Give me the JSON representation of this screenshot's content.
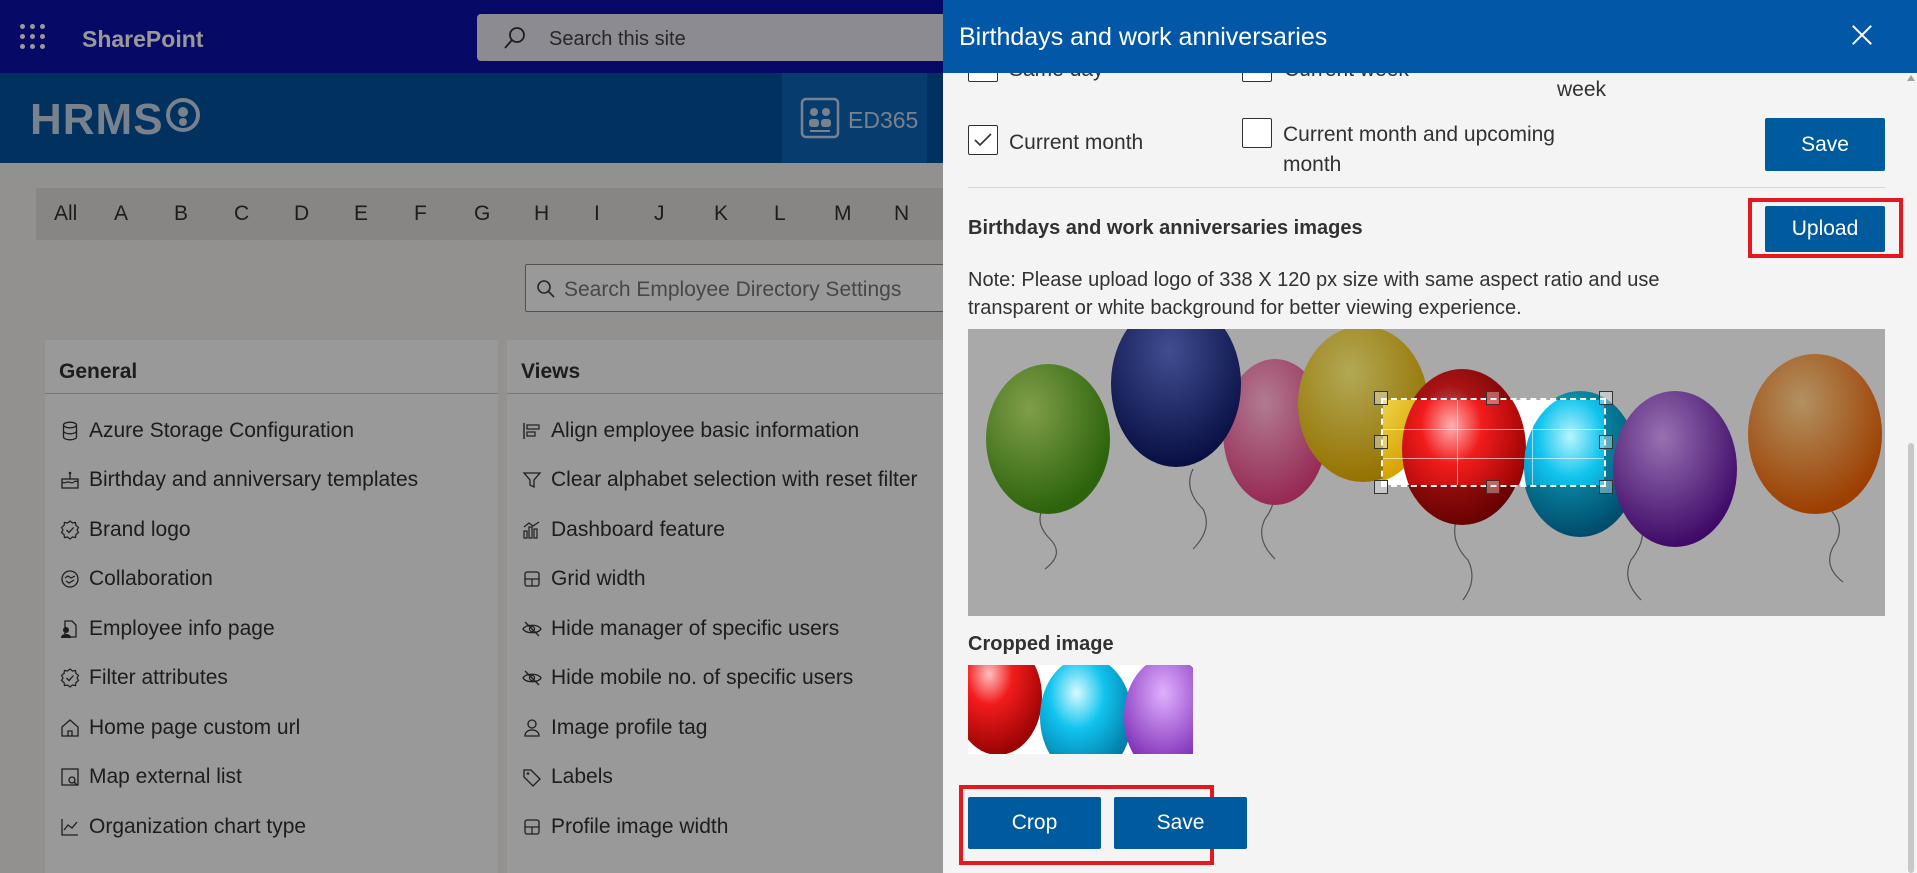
{
  "suitebar": {
    "app_name": "SharePoint",
    "search_placeholder": "Search this site"
  },
  "header": {
    "logo_text": "HRMS",
    "tab_label": "ED365"
  },
  "alphabet": [
    "All",
    "A",
    "B",
    "C",
    "D",
    "E",
    "F",
    "G",
    "H",
    "I",
    "J",
    "K",
    "L",
    "M",
    "N"
  ],
  "directory_search_placeholder": "Search Employee Directory Settings",
  "general": {
    "title": "General",
    "items": [
      {
        "label": "Azure Storage Configuration",
        "icon": "database-icon"
      },
      {
        "label": "Birthday and anniversary templates",
        "icon": "cake-icon"
      },
      {
        "label": "Brand logo",
        "icon": "badge-icon"
      },
      {
        "label": "Collaboration",
        "icon": "handshake-icon"
      },
      {
        "label": "Employee info page",
        "icon": "person-doc-icon"
      },
      {
        "label": "Filter attributes",
        "icon": "badge-check-icon"
      },
      {
        "label": "Home page custom url",
        "icon": "home-icon"
      },
      {
        "label": "Map external list",
        "icon": "map-icon"
      },
      {
        "label": "Organization chart type",
        "icon": "chart-icon"
      }
    ]
  },
  "views": {
    "title": "Views",
    "items": [
      {
        "label": "Align employee basic information",
        "icon": "align-left-icon"
      },
      {
        "label": "Clear alphabet selection with reset filter",
        "icon": "filter-icon"
      },
      {
        "label": "Dashboard feature",
        "icon": "bar-chart-icon"
      },
      {
        "label": "Grid width",
        "icon": "grid-icon"
      },
      {
        "label": "Hide manager of specific users",
        "icon": "eye-off-icon"
      },
      {
        "label": "Hide mobile no. of specific users",
        "icon": "eye-off-icon"
      },
      {
        "label": "Image profile tag",
        "icon": "person-icon"
      },
      {
        "label": "Labels",
        "icon": "tag-icon"
      },
      {
        "label": "Profile image width",
        "icon": "grid-icon"
      }
    ]
  },
  "panel": {
    "title": "Birthdays and work anniversaries",
    "partial_labels": {
      "same_day": "Same day",
      "current_week": "Current week",
      "week": "week"
    },
    "options": {
      "current_month": {
        "label": "Current month",
        "checked": true
      },
      "current_and_upcoming_line1": "Current month and upcoming",
      "current_and_upcoming_line2": "month",
      "current_and_upcoming_checked": false
    },
    "save_top_label": "Save",
    "images_section_title": "Birthdays and work anniversaries images",
    "upload_label": "Upload",
    "note": "Note: Please upload logo of 338 X 120 px size with same aspect ratio and use transparent or white background for better viewing experience.",
    "cropped_image_title": "Cropped image",
    "crop_label": "Crop",
    "save_bottom_label": "Save"
  },
  "colors": {
    "suitebar": "#0a10a8",
    "site_header": "#02529e",
    "panel_header": "#0258a7",
    "primary_button": "#005a9e",
    "highlight": "#e3191f"
  }
}
